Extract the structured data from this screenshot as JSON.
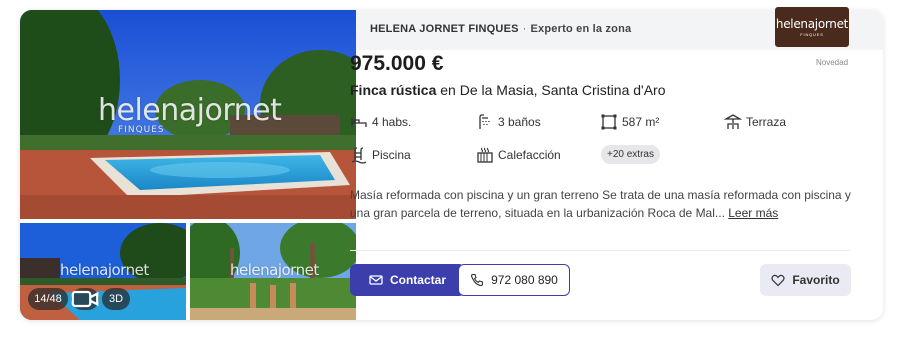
{
  "agency": {
    "name": "HELENA JORNET FINQUES",
    "separator": "·",
    "tag": "Experto en la zona",
    "logo_word": "helenajornet",
    "logo_sub": "FINQUES"
  },
  "gallery": {
    "watermark": "helenajornet",
    "watermark_sub": "FINQUES",
    "photo_count": "14/48",
    "video_icon": "video-icon",
    "three_d": "3D"
  },
  "listing": {
    "price": "975.000 €",
    "badge": "Novedad",
    "type": "Finca rústica",
    "location": " en De la Masia, Santa Cristina d'Aro",
    "features": {
      "rooms": "4 habs.",
      "baths": "3 baños",
      "area": "587 m²",
      "terrace": "Terraza",
      "pool": "Piscina",
      "heating": "Calefacción",
      "extras": "+20 extras"
    },
    "description": "Masía reformada con piscina y un gran terreno Se trata de una masía reformada con piscina y una gran parcela de terreno, situada en la urbanización Roca de Mal...",
    "read_more": "Leer más"
  },
  "actions": {
    "contact": "Contactar",
    "phone": "972 080 890",
    "favorite": "Favorito"
  },
  "colors": {
    "primary": "#3c3eac",
    "favorite_bg": "#eaeaf5",
    "agency_bar": "#f3f4f6",
    "logo_bg": "#4a2a1c"
  }
}
